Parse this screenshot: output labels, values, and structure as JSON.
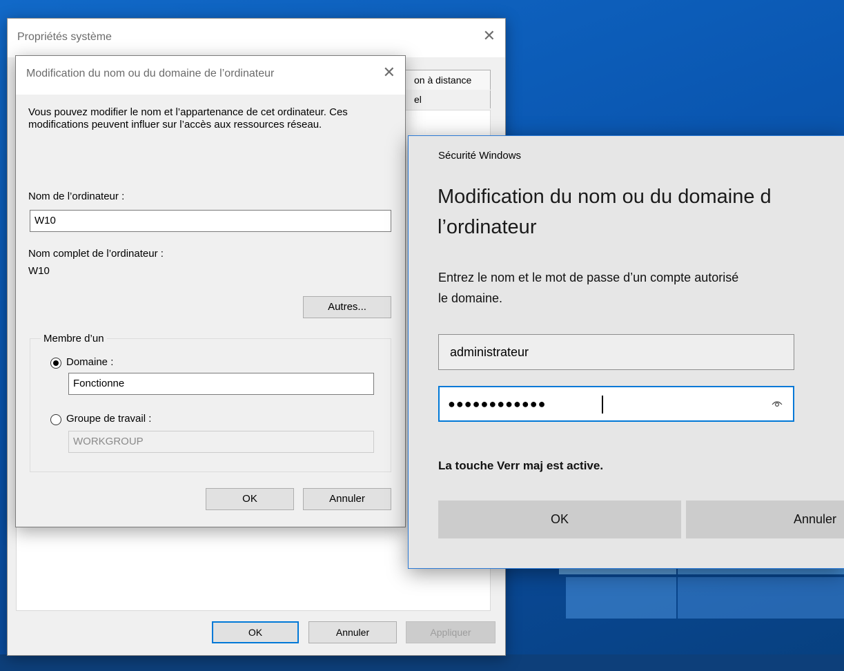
{
  "system_properties": {
    "title": "Propriétés système",
    "tab_fragment_1": "on à distance",
    "tab_fragment_2": "el",
    "buttons": {
      "ok": "OK",
      "cancel": "Annuler",
      "apply": "Appliquer"
    }
  },
  "rename_dialog": {
    "title": "Modification du nom ou du domaine de l’ordinateur",
    "description": "Vous pouvez modifier le nom et l’appartenance de cet ordinateur. Ces modifications peuvent influer sur l’accès aux ressources réseau.",
    "computer_name_label": "Nom de l’ordinateur :",
    "computer_name_value": "W10",
    "full_name_label": "Nom complet de l’ordinateur :",
    "full_name_value": "W10",
    "more_button": "Autres...",
    "member_of_label": "Membre d’un",
    "domain_label": "Domaine :",
    "domain_value": "Fonctionne",
    "domain_selected": true,
    "workgroup_label": "Groupe de travail :",
    "workgroup_value": "WORKGROUP",
    "ok_button": "OK",
    "cancel_button": "Annuler"
  },
  "security_dialog": {
    "caption": "Sécurité Windows",
    "heading_line1": "Modification du nom ou du domaine d",
    "heading_line2": "l’ordinateur",
    "instruction_line1": "Entrez le nom et le mot de passe d’un compte autorisé",
    "instruction_line2": "le domaine.",
    "username_value": "administrateur",
    "password_mask": "●●●●●●●●●●●●",
    "caps_lock_warning": "La touche Verr maj est active.",
    "ok_button": "OK",
    "cancel_button": "Annuler",
    "accent_color": "#0078d7"
  }
}
